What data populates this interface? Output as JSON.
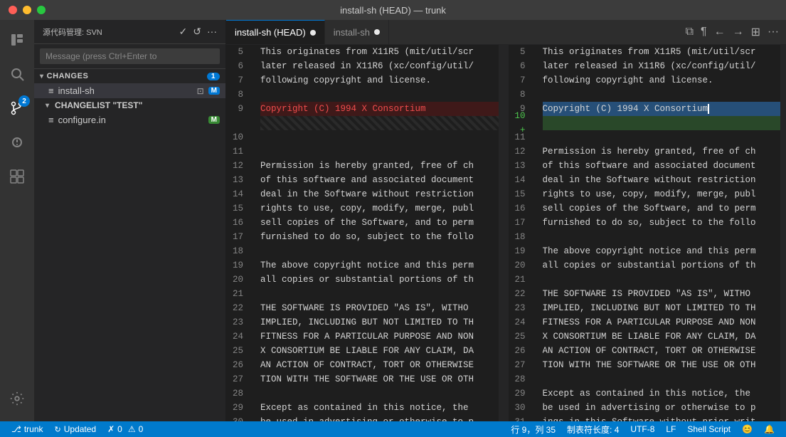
{
  "titleBar": {
    "title": "install-sh (HEAD) — trunk"
  },
  "activityBar": {
    "items": [
      {
        "name": "explorer",
        "icon": "📄",
        "badge": null
      },
      {
        "name": "search",
        "icon": "🔍",
        "badge": null
      },
      {
        "name": "scm",
        "icon": "⑂",
        "badge": "2"
      },
      {
        "name": "debug",
        "icon": "⊗",
        "badge": null
      },
      {
        "name": "extensions",
        "icon": "⊞",
        "badge": null
      }
    ],
    "bottom": [
      {
        "name": "settings",
        "icon": "⚙"
      }
    ]
  },
  "sidebar": {
    "header": {
      "label": "源代码管理: SVN",
      "icons": [
        "✓",
        "↺",
        "···"
      ]
    },
    "input": {
      "placeholder": "Message (press Ctrl+Enter to"
    },
    "sections": {
      "changes": {
        "label": "CHANGES",
        "count": "1",
        "files": [
          {
            "name": "install-sh",
            "badge": "M",
            "badgeColor": "blue"
          }
        ]
      },
      "changelist": {
        "label": "CHANGELIST \"TEST\"",
        "files": [
          {
            "name": "configure.in",
            "badge": "M",
            "badgeColor": "green"
          }
        ]
      }
    }
  },
  "tabBar": {
    "tabs": [
      {
        "label": "install-sh (HEAD)",
        "active": true,
        "dot": true
      },
      {
        "label": "install-sh",
        "active": false,
        "dot": true
      }
    ],
    "actions": [
      "⬛",
      "¶",
      "←",
      "→",
      "⊞",
      "···"
    ]
  },
  "leftPane": {
    "lines": [
      {
        "num": "5",
        "text": "This originates from X11R5 (mit/util/sc"
      },
      {
        "num": "6",
        "text": "later released in X11R6 (xc/config/util/"
      },
      {
        "num": "7",
        "text": "following copyright and license."
      },
      {
        "num": "8",
        "text": ""
      },
      {
        "num": "9",
        "text": "Copyright (C) 1994 X Consortium",
        "deleted": true
      },
      {
        "num": "",
        "text": "",
        "empty": true
      },
      {
        "num": "10",
        "text": ""
      },
      {
        "num": "11",
        "text": ""
      },
      {
        "num": "12",
        "text": "Permission is hereby granted, free of ch"
      },
      {
        "num": "13",
        "text": "of this software and associated document"
      },
      {
        "num": "14",
        "text": "deal in the Software without restriction"
      },
      {
        "num": "15",
        "text": "rights to use, copy, modify, merge, publ"
      },
      {
        "num": "16",
        "text": "sell copies of the Software, and to perm"
      },
      {
        "num": "17",
        "text": "furnished to do so, subject to the follo"
      },
      {
        "num": "18",
        "text": ""
      },
      {
        "num": "19",
        "text": "The above copyright notice and this perm"
      },
      {
        "num": "20",
        "text": "all copies or substantial portions of th"
      },
      {
        "num": "21",
        "text": ""
      },
      {
        "num": "22",
        "text": "THE SOFTWARE IS PROVIDED \"AS IS\", WITHO"
      },
      {
        "num": "23",
        "text": "IMPLIED, INCLUDING BUT NOT LIMITED TO TH"
      },
      {
        "num": "24",
        "text": "FITNESS FOR A PARTICULAR PURPOSE AND NON"
      },
      {
        "num": "25",
        "text": "X CONSORTIUM BE LIABLE FOR ANY CLAIM, DA"
      },
      {
        "num": "26",
        "text": "AN ACTION OF CONTRACT, TORT OR OTHERWISE"
      },
      {
        "num": "27",
        "text": "TION WITH THE SOFTWARE OR THE USE OR OTH"
      },
      {
        "num": "28",
        "text": ""
      },
      {
        "num": "29",
        "text": "Except as contained in this notice, the "
      },
      {
        "num": "30",
        "text": "be used in advertising or otherwise to p"
      }
    ]
  },
  "rightPane": {
    "lines": [
      {
        "num": "5",
        "text": "This originates from X11R5 (mit/util/scr"
      },
      {
        "num": "6",
        "text": "later released in X11R6 (xc/config/util/"
      },
      {
        "num": "7",
        "text": "following copyright and license."
      },
      {
        "num": "8",
        "text": ""
      },
      {
        "num": "9",
        "text": "Copyright (C) 1994 X Consortium",
        "highlighted": true,
        "cursor": true
      },
      {
        "num": "10",
        "text": "",
        "added": true
      },
      {
        "num": "11",
        "text": ""
      },
      {
        "num": "12",
        "text": "Permission is hereby granted, free of ch"
      },
      {
        "num": "13",
        "text": "of this software and associated document"
      },
      {
        "num": "14",
        "text": "deal in the Software without restriction"
      },
      {
        "num": "15",
        "text": "rights to use, copy, modify, merge, publ"
      },
      {
        "num": "16",
        "text": "sell copies of the Software, and to perm"
      },
      {
        "num": "17",
        "text": "furnished to do so, subject to the follo"
      },
      {
        "num": "18",
        "text": ""
      },
      {
        "num": "19",
        "text": "The above copyright notice and this perm"
      },
      {
        "num": "20",
        "text": "all copies or substantial portions of th"
      },
      {
        "num": "21",
        "text": ""
      },
      {
        "num": "22",
        "text": "THE SOFTWARE IS PROVIDED \"AS IS\", WITHO"
      },
      {
        "num": "23",
        "text": "IMPLIED, INCLUDING BUT NOT LIMITED TO TH"
      },
      {
        "num": "24",
        "text": "FITNESS FOR A PARTICULAR PURPOSE AND NON"
      },
      {
        "num": "25",
        "text": "X CONSORTIUM BE LIABLE FOR ANY CLAIM, DA"
      },
      {
        "num": "26",
        "text": "AN ACTION OF CONTRACT, TORT OR OTHERWISE"
      },
      {
        "num": "27",
        "text": "TION WITH THE SOFTWARE OR THE USE OR OTH"
      },
      {
        "num": "28",
        "text": ""
      },
      {
        "num": "29",
        "text": "Except as contained in this notice, the"
      },
      {
        "num": "30",
        "text": "be used in advertising or otherwise to p"
      },
      {
        "num": "31",
        "text": "ings in this Software without prior writ"
      }
    ]
  },
  "statusBar": {
    "branch": "trunk",
    "sync": "Updated",
    "errors": "0",
    "warnings": "0",
    "position": "行 9，列 35",
    "tabSize": "制表符长度: 4",
    "encoding": "UTF-8",
    "lineEnding": "LF",
    "language": "Shell Script",
    "emoji": "😊",
    "bell": "🔔"
  }
}
